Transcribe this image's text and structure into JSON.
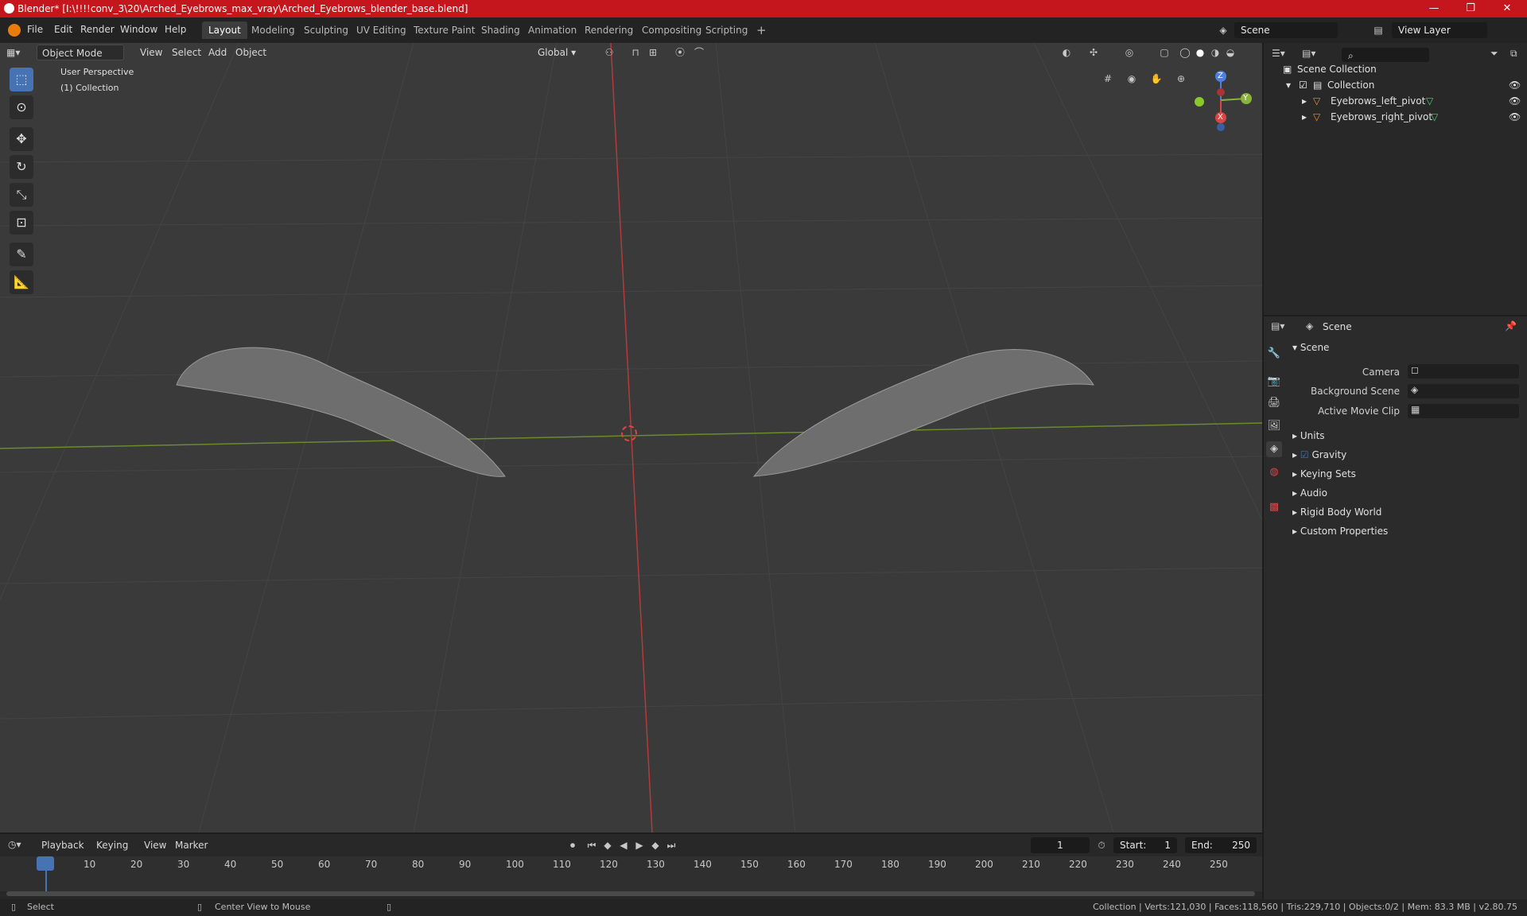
{
  "window": {
    "title": "Blender* [I:\\!!!!conv_3\\20\\Arched_Eyebrows_max_vray\\Arched_Eyebrows_blender_base.blend]",
    "minimize": "—",
    "maximize": "❐",
    "close": "✕"
  },
  "menubar": {
    "items": [
      "File",
      "Edit",
      "Render",
      "Window",
      "Help"
    ],
    "workspaces": [
      "Layout",
      "Modeling",
      "Sculpting",
      "UV Editing",
      "Texture Paint",
      "Shading",
      "Animation",
      "Rendering",
      "Compositing",
      "Scripting"
    ],
    "add_tab": "+",
    "scene_name": "Scene",
    "view_layer": "View Layer"
  },
  "viewport_header": {
    "mode": "Object Mode",
    "menus": [
      "View",
      "Select",
      "Add",
      "Object"
    ],
    "transform_orientation": "Global"
  },
  "viewport": {
    "perspective": "User Perspective",
    "collection": "(1) Collection",
    "gizmo": {
      "z": "Z",
      "y": "Y",
      "x": "X"
    }
  },
  "outliner": {
    "search_placeholder": "",
    "scene_collection": "Scene Collection",
    "collection": "Collection",
    "objects": [
      "Eyebrows_left_pivot",
      "Eyebrows_right_pivot"
    ]
  },
  "properties": {
    "header": "Scene",
    "panel": "Scene",
    "fields": {
      "camera": "Camera",
      "background_scene": "Background Scene",
      "active_movie_clip": "Active Movie Clip"
    },
    "sections": [
      "Units",
      "Gravity",
      "Keying Sets",
      "Audio",
      "Rigid Body World",
      "Custom Properties"
    ]
  },
  "timeline": {
    "menus": [
      "Playback",
      "Keying",
      "View",
      "Marker"
    ],
    "current_frame": "1",
    "start_label": "Start:",
    "start": "1",
    "end_label": "End:",
    "end": "250",
    "ruler": [
      "1",
      "10",
      "20",
      "30",
      "40",
      "50",
      "60",
      "70",
      "80",
      "90",
      "100",
      "110",
      "120",
      "130",
      "140",
      "150",
      "160",
      "170",
      "180",
      "190",
      "200",
      "210",
      "220",
      "230",
      "240",
      "250"
    ]
  },
  "statusbar": {
    "select": "Select",
    "center_view": "Center View to Mouse",
    "stats": "Collection | Verts:121,030 | Faces:118,560 | Tris:229,710 | Objects:0/2 | Mem: 83.3 MB | v2.80.75"
  }
}
